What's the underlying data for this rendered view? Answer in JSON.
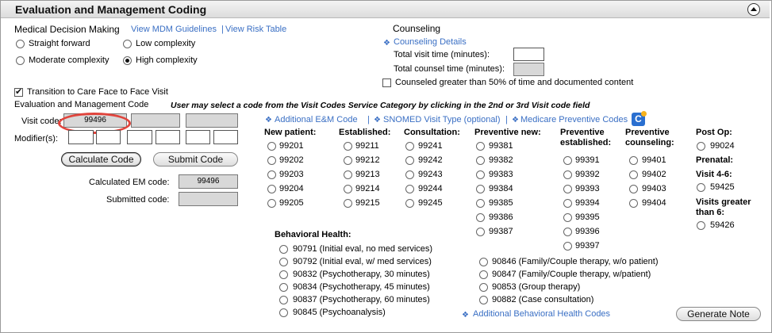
{
  "header": {
    "title": "Evaluation and Management Coding"
  },
  "mdm": {
    "label": "Medical Decision Making",
    "links": [
      "View MDM Guidelines",
      "View Risk Table"
    ],
    "separator": "|",
    "options": [
      {
        "label": "Straight forward",
        "checked": false
      },
      {
        "label": "Low complexity",
        "checked": false
      },
      {
        "label": "Moderate complexity",
        "checked": false
      },
      {
        "label": "High complexity",
        "checked": true
      }
    ]
  },
  "counseling": {
    "label": "Counseling",
    "details_link": "Counseling Details",
    "total_visit_label": "Total visit time (minutes):",
    "total_counsel_label": "Total counsel time (minutes):",
    "greater_label": "Counseled greater than 50% of time and documented content"
  },
  "transition": {
    "label": "Transition to Care Face to Face Visit",
    "checked": true
  },
  "em": {
    "label": "Evaluation and Management Code",
    "hint": "User may select a code from the Visit Codes Service Category by clicking in the 2nd or 3rd Visit code field",
    "visit_code_label": "Visit code:",
    "visit_code_value": "99496",
    "modifiers_label": "Modifier(s):",
    "calculate_button": "Calculate Code",
    "submit_button": "Submit Code",
    "calculated_label": "Calculated EM code:",
    "calculated_value": "99496",
    "submitted_label": "Submitted code:"
  },
  "links": {
    "additional_em": "Additional E&M Code",
    "snomed": "SNOMED Visit Type (optional)",
    "medicare": "Medicare Preventive Codes",
    "medicare_icon_letter": "C",
    "additional_behavioral": "Additional Behavioral Health Codes",
    "sep": "|"
  },
  "columns": {
    "new_patient": {
      "header": "New patient:",
      "codes": [
        "99201",
        "99202",
        "99203",
        "99204",
        "99205"
      ]
    },
    "established": {
      "header": "Established:",
      "codes": [
        "99211",
        "99212",
        "99213",
        "99214",
        "99215"
      ]
    },
    "consultation": {
      "header": "Consultation:",
      "codes": [
        "99241",
        "99242",
        "99243",
        "99244",
        "99245"
      ]
    },
    "preventive_new": {
      "header": "Preventive new:",
      "codes": [
        "99381",
        "99382",
        "99383",
        "99384",
        "99385",
        "99386",
        "99387"
      ]
    },
    "preventive_established": {
      "header_line1": "Preventive",
      "header_line2": "established:",
      "codes": [
        "99391",
        "99392",
        "99393",
        "99394",
        "99395",
        "99396",
        "99397"
      ]
    },
    "preventive_counseling": {
      "header_line1": "Preventive",
      "header_line2": "counseling:",
      "codes": [
        "99401",
        "99402",
        "99403",
        "99404"
      ]
    },
    "post_op": {
      "header": "Post Op:",
      "code": "99024"
    },
    "prenatal": {
      "header": "Prenatal:"
    },
    "visit_4_6": {
      "header": "Visit 4-6:",
      "code": "59425"
    },
    "visits_greater": {
      "header_line1": "Visits greater",
      "header_line2": "than 6:",
      "code": "59426"
    }
  },
  "behavioral": {
    "header": "Behavioral Health:",
    "left": [
      "90791 (Initial eval, no med services)",
      "90792 (Initial eval, w/ med services)",
      "90832 (Psychotherapy, 30 minutes)",
      "90834 (Psychotherapy, 45 minutes)",
      "90837 (Psychotherapy, 60 minutes)",
      "90845 (Psychoanalysis)"
    ],
    "right": [
      "90846 (Family/Couple therapy, w/o patient)",
      "90847 (Family/Couple therapy, w/patient)",
      "90853 (Group therapy)",
      "90882 (Case consultation)"
    ]
  },
  "generate_button": "Generate Note"
}
